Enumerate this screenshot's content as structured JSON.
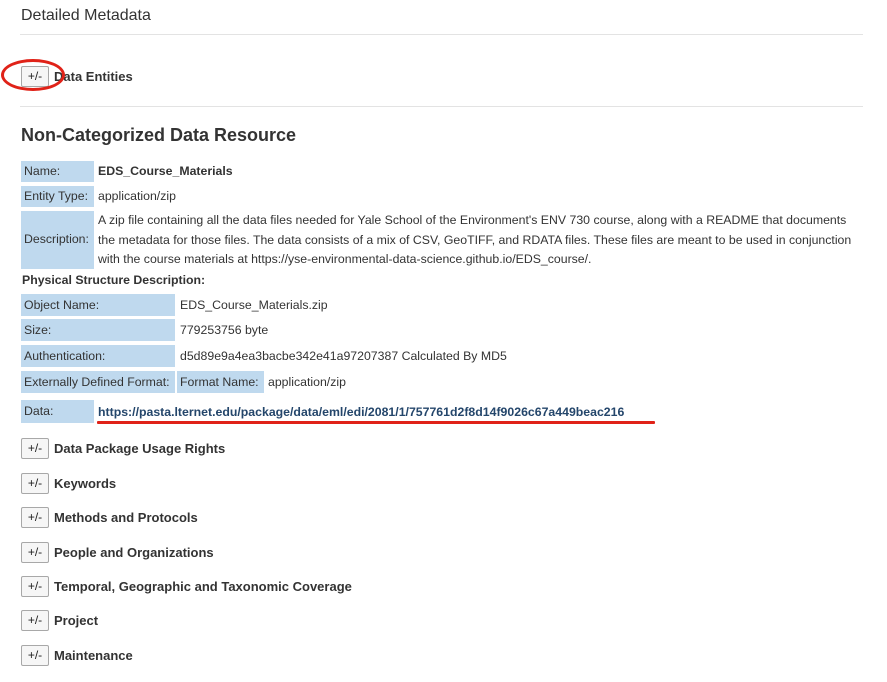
{
  "page": {
    "title": "Detailed Metadata"
  },
  "toggle_symbol": "+/-",
  "data_entities": {
    "label": "Data Entities"
  },
  "resource": {
    "title": "Non-Categorized Data Resource",
    "rows": {
      "name": {
        "label": "Name:",
        "value": "EDS_Course_Materials"
      },
      "entity_type": {
        "label": "Entity Type:",
        "value": "application/zip"
      },
      "description": {
        "label": "Description:",
        "value": "A zip file containing all the data files needed for Yale School of the Environment's ENV 730 course, along with a README that documents the metadata for those files. The data consists of a mix of CSV, GeoTIFF, and RDATA files. These files are meant to be used in conjunction with the course materials at https://yse-environmental-data-science.github.io/EDS_course/."
      }
    },
    "physical": {
      "title": "Physical Structure Description:",
      "object_name": {
        "label": "Object Name:",
        "value": "EDS_Course_Materials.zip"
      },
      "size": {
        "label": "Size:",
        "value": "779253756 byte"
      },
      "authentication": {
        "label": "Authentication:",
        "value": "d5d89e9a4ea3bacbe342e41a97207387 Calculated By MD5"
      },
      "external_format": {
        "label": "Externally Defined Format:",
        "sub_label": "Format Name:",
        "value": "application/zip"
      },
      "data": {
        "label": "Data:",
        "link": "https://pasta.lternet.edu/package/data/eml/edi/2081/1/757761d2f8d14f9026c67a449beac216"
      }
    }
  },
  "sections": [
    "Data Package Usage Rights",
    "Keywords",
    "Methods and Protocols",
    "People and Organizations",
    "Temporal, Geographic and Taxonomic Coverage",
    "Project",
    "Maintenance"
  ],
  "colors": {
    "label_bg": "#bfd9ee",
    "link": "#24466b",
    "annotation_red": "#e02218"
  }
}
